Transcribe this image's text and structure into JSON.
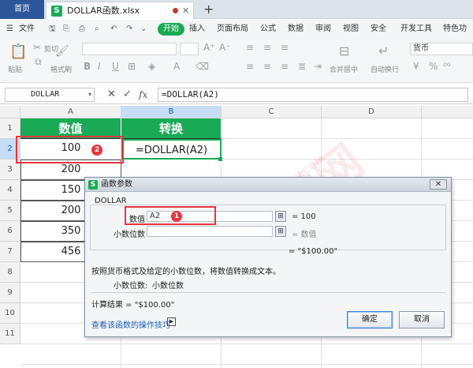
{
  "tabs": {
    "home": "首页",
    "file": "DOLLAR函数.xlsx",
    "plus": "+"
  },
  "menu": {
    "file": "文件",
    "start": "开始",
    "items": [
      "插入",
      "页面布局",
      "公式",
      "数据",
      "审阅",
      "视图",
      "安全",
      "开发工具",
      "特色功能"
    ]
  },
  "ribbon": {
    "paste": "粘贴",
    "cut_label": "剪切",
    "format_painter": "格式刷",
    "merge_center": "合并居中",
    "auto_wrap": "自动换行",
    "number_format": "货币"
  },
  "formula_bar": {
    "name_box": "DOLLAR",
    "cancel": "✕",
    "confirm": "✓",
    "fx": "fx",
    "formula": "=DOLLAR(A2)"
  },
  "sheet": {
    "columns": [
      "A",
      "B",
      "C",
      "D"
    ],
    "rows": [
      "1",
      "2",
      "3",
      "4",
      "5",
      "6",
      "7",
      "8",
      "9",
      "10",
      "11"
    ],
    "header_a": "数值",
    "header_b": "转换",
    "values": [
      "100",
      "200",
      "150",
      "200",
      "350",
      "456"
    ],
    "b2": "=DOLLAR(A2)"
  },
  "badges": {
    "one": "1",
    "two": "2"
  },
  "dialog": {
    "title": "函数参数",
    "func_name": "DOLLAR",
    "arg1_label": "数值",
    "arg1_value": "A2",
    "arg1_result": "= 100",
    "arg2_label": "小数位数",
    "arg2_result": "= 数值",
    "overall_result": "= \"$100.00\"",
    "description": "按照货币格式及给定的小数位数，将数值转换成文本。",
    "param_desc_label": "小数位数:",
    "param_desc_text": "小数位数",
    "calc_result": "计算结果 = \"$100.00\"",
    "help_link": "查看该函数的操作技巧",
    "ok": "确定",
    "cancel": "取消"
  },
  "watermark": {
    "main": "软件自学网",
    "url": "WWW.RJZXW.COM"
  },
  "colors": {
    "accent_green": "#1aaa55",
    "badge_red": "#e8353f",
    "tab_blue": "#2b579a"
  }
}
